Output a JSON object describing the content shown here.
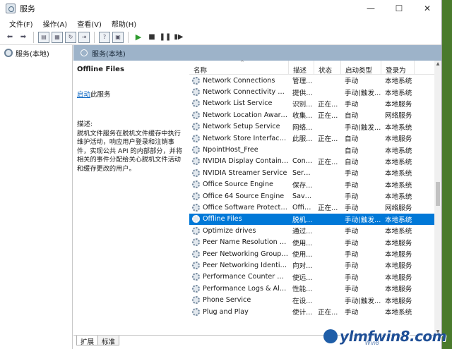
{
  "window": {
    "title": "服务"
  },
  "menu": [
    "文件(F)",
    "操作(A)",
    "查看(V)",
    "帮助(H)"
  ],
  "nav": {
    "root_label": "服务(本地)"
  },
  "header": {
    "title": "服务(本地)"
  },
  "detail": {
    "service_name": "Offline Files",
    "start_link": "启动",
    "start_suffix": "此服务",
    "desc_label": "描述:",
    "desc_text": "脱机文件服务在脱机文件缓存中执行维护活动，响应用户登录和注销事件，实现公共 API 的内部部分，并将相关的事件分配给关心脱机文件活动和缓存更改的用户。"
  },
  "columns": {
    "name": "名称",
    "desc": "描述",
    "status": "状态",
    "start": "启动类型",
    "logon": "登录为"
  },
  "rows": [
    {
      "name": "Network Connections",
      "desc": "管理...",
      "status": "",
      "start": "手动",
      "logon": "本地系统"
    },
    {
      "name": "Network Connectivity Ass...",
      "desc": "提供 ...",
      "status": "",
      "start": "手动(触发...",
      "logon": "本地系统"
    },
    {
      "name": "Network List Service",
      "desc": "识别...",
      "status": "正在...",
      "start": "手动",
      "logon": "本地服务"
    },
    {
      "name": "Network Location Aware...",
      "desc": "收集...",
      "status": "正在...",
      "start": "自动",
      "logon": "网络服务"
    },
    {
      "name": "Network Setup Service",
      "desc": "网络...",
      "status": "",
      "start": "手动(触发...",
      "logon": "本地系统"
    },
    {
      "name": "Network Store Interface ...",
      "desc": "此服...",
      "status": "正在...",
      "start": "自动",
      "logon": "本地服务"
    },
    {
      "name": "NpointHost_Free",
      "desc": "",
      "status": "",
      "start": "自动",
      "logon": "本地系统"
    },
    {
      "name": "NVIDIA Display Containe...",
      "desc": "Cont...",
      "status": "正在...",
      "start": "自动",
      "logon": "本地系统"
    },
    {
      "name": "NVIDIA Streamer Service",
      "desc": "Servi...",
      "status": "",
      "start": "手动",
      "logon": "本地系统"
    },
    {
      "name": "Office  Source Engine",
      "desc": "保存...",
      "status": "",
      "start": "手动",
      "logon": "本地系统"
    },
    {
      "name": "Office 64 Source Engine",
      "desc": "Save...",
      "status": "",
      "start": "手动",
      "logon": "本地系统"
    },
    {
      "name": "Office Software Protectio...",
      "desc": "Offic...",
      "status": "正在...",
      "start": "手动",
      "logon": "网络服务"
    },
    {
      "name": "Offline Files",
      "desc": "脱机...",
      "status": "",
      "start": "手动(触发...",
      "logon": "本地系统",
      "selected": true
    },
    {
      "name": "Optimize drives",
      "desc": "通过...",
      "status": "",
      "start": "手动",
      "logon": "本地系统"
    },
    {
      "name": "Peer Name Resolution Pr...",
      "desc": "使用...",
      "status": "",
      "start": "手动",
      "logon": "本地服务"
    },
    {
      "name": "Peer Networking Groupi...",
      "desc": "使用...",
      "status": "",
      "start": "手动",
      "logon": "本地服务"
    },
    {
      "name": "Peer Networking Identity...",
      "desc": "向对...",
      "status": "",
      "start": "手动",
      "logon": "本地服务"
    },
    {
      "name": "Performance Counter DL...",
      "desc": "使远...",
      "status": "",
      "start": "手动",
      "logon": "本地服务"
    },
    {
      "name": "Performance Logs & Aler...",
      "desc": "性能...",
      "status": "",
      "start": "手动",
      "logon": "本地服务"
    },
    {
      "name": "Phone Service",
      "desc": "在设...",
      "status": "",
      "start": "手动(触发...",
      "logon": "本地服务"
    },
    {
      "name": "Plug and Play",
      "desc": "使计...",
      "status": "正在...",
      "start": "手动",
      "logon": "本地系统"
    }
  ],
  "tabs": [
    "扩展",
    "标准"
  ],
  "watermark": {
    "text": "ylmfwin8.com",
    "sub": "Win8"
  }
}
